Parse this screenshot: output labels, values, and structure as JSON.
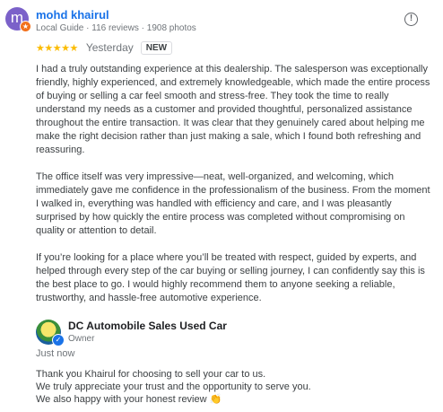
{
  "review": {
    "author_initial": "m",
    "author_name": "mohd khairul",
    "author_meta": "Local Guide · 116 reviews · 1908 photos",
    "rating_stars": 5,
    "stars_text": "★★★★★",
    "time": "Yesterday",
    "new_badge": "NEW",
    "report_icon_text": "!",
    "paragraphs": [
      "I had a truly outstanding experience at this dealership. The salesperson was exceptionally friendly, highly experienced, and extremely knowledgeable, which made the entire process of buying or selling a car feel smooth and stress-free. They took the time to really understand my needs as a customer and provided thoughtful, personalized assistance throughout the entire transaction. It was clear that they genuinely cared about helping me make the right decision rather than just making a sale, which I found both refreshing and reassuring.",
      "The office itself was very impressive—neat, well-organized, and welcoming, which immediately gave me confidence in the professionalism of the business. From the moment I walked in, everything was handled with efficiency and care, and I was pleasantly surprised by how quickly the entire process was completed without compromising on quality or attention to detail.",
      "If you’re looking for a place where you’ll be treated with respect, guided by experts, and helped through every step of the car buying or selling journey, I can confidently say this is the best place to go. I would highly recommend them to anyone seeking a reliable, trustworthy, and hassle-free automotive experience."
    ]
  },
  "owner_reply": {
    "name": "DC Automobile Sales Used Car",
    "role": "Owner",
    "time": "Just now",
    "lines": [
      "Thank you Khairul for choosing to sell your car to us.",
      "We truly appreciate your trust and the opportunity to serve you.",
      "We also happy with your honest review 👏"
    ]
  },
  "icons": {
    "avatar_badge": "local-guide-badge-icon",
    "report": "report-flag-icon",
    "owner_verified": "verified-check-icon"
  },
  "colors": {
    "author_link": "#1a73e8",
    "star": "#fbbc04",
    "avatar_bg": "#7b61c9",
    "badge_orange": "#f2711c"
  }
}
